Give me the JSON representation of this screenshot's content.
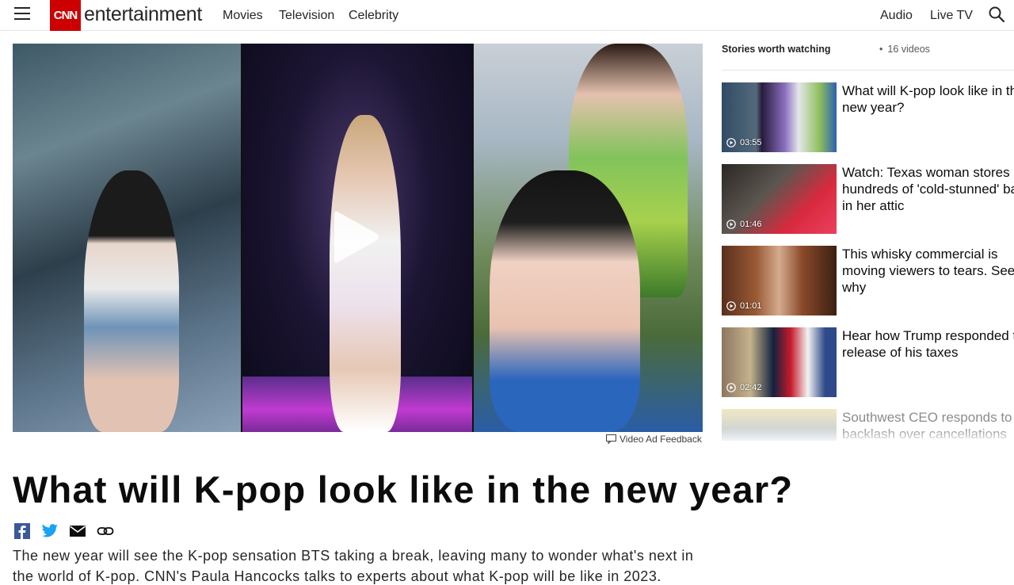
{
  "header": {
    "logo_text": "CNN",
    "section": "entertainment",
    "nav": [
      "Movies",
      "Television",
      "Celebrity"
    ],
    "right_links": [
      "Audio",
      "Live TV"
    ],
    "accent_color": "#cc0000"
  },
  "video": {
    "feedback_label": "Video Ad Feedback",
    "headline": "What will K-pop look like in the new year?",
    "description": "The new year will see the K-pop sensation BTS taking a break, leaving many to wonder what's next in the world of K-pop. CNN's Paula Hancocks talks to experts about what K-pop will be like in 2023.",
    "share_icons": [
      "facebook-icon",
      "twitter-icon",
      "email-icon",
      "link-icon"
    ]
  },
  "playlist": {
    "title": "Stories worth watching",
    "count": "16 videos",
    "items": [
      {
        "title": "What will K-pop look like in the new year?",
        "duration": "03:55"
      },
      {
        "title": "Watch: Texas woman stores hundreds of 'cold-stunned' bats in her attic",
        "duration": "01:46"
      },
      {
        "title": "This whisky commercial is moving viewers to tears. See why",
        "duration": "01:01"
      },
      {
        "title": "Hear how Trump responded to release of his taxes",
        "duration": "02:42"
      },
      {
        "title": "Southwest CEO responds to backlash over cancellations",
        "duration": ""
      }
    ]
  }
}
